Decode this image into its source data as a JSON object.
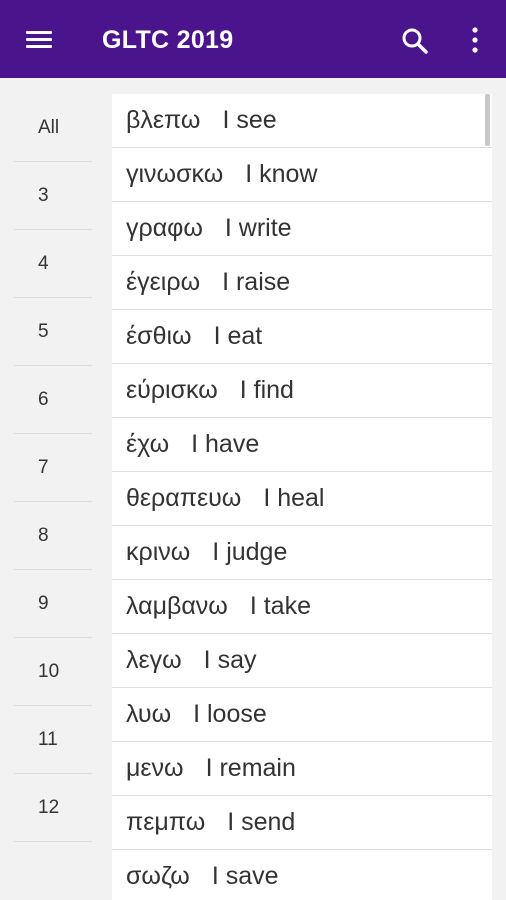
{
  "appbar": {
    "title": "GLTC 2019",
    "menu_icon": "hamburger-menu-icon",
    "search_icon": "search-icon",
    "more_icon": "more-vert-icon",
    "background": "#4a148c"
  },
  "chapters": [
    {
      "label": "All"
    },
    {
      "label": "3"
    },
    {
      "label": "4"
    },
    {
      "label": "5"
    },
    {
      "label": "6"
    },
    {
      "label": "7"
    },
    {
      "label": "8"
    },
    {
      "label": "9"
    },
    {
      "label": "10"
    },
    {
      "label": "11"
    },
    {
      "label": "12"
    }
  ],
  "vocab": [
    {
      "greek": "βλεπω",
      "english": "I see"
    },
    {
      "greek": "γινωσκω",
      "english": "I know"
    },
    {
      "greek": "γραφω",
      "english": "I write"
    },
    {
      "greek": "έγειρω",
      "english": "I raise"
    },
    {
      "greek": "έσθιω",
      "english": "I eat"
    },
    {
      "greek": "εύρισκω",
      "english": "I find"
    },
    {
      "greek": "έχω",
      "english": "I have"
    },
    {
      "greek": "θεραπευω",
      "english": "I heal"
    },
    {
      "greek": "κρινω",
      "english": "I judge"
    },
    {
      "greek": "λαμβανω",
      "english": "I take"
    },
    {
      "greek": "λεγω",
      "english": "I say"
    },
    {
      "greek": "λυω",
      "english": "I loose"
    },
    {
      "greek": "μενω",
      "english": "I remain"
    },
    {
      "greek": "πεμπω",
      "english": "I send"
    },
    {
      "greek": "σωζω",
      "english": "I save"
    }
  ]
}
